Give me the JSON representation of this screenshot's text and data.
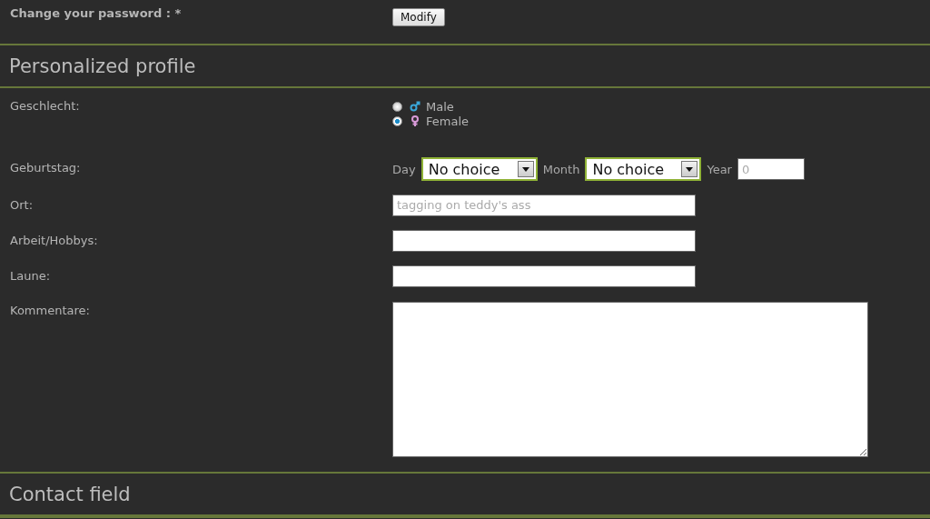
{
  "password_row": {
    "label": "Change your password : *",
    "button": "Modify"
  },
  "sections": [
    {
      "title": "Personalized profile",
      "fields": [
        {
          "kind": "radio",
          "label": "Geschlecht:",
          "options": [
            {
              "label": "Male",
              "kind": "male",
              "selected": false
            },
            {
              "label": "Female",
              "kind": "female",
              "selected": true
            }
          ]
        },
        {
          "kind": "date",
          "label": "Geburtstag:",
          "parts": [
            {
              "kind": "select",
              "label": "Day",
              "value": "No choice"
            },
            {
              "kind": "select",
              "label": "Month",
              "value": "No choice"
            },
            {
              "kind": "text",
              "label": "Year",
              "placeholder": "0"
            }
          ]
        },
        {
          "kind": "text",
          "label": "Ort:",
          "placeholder": "tagging on teddy's ass"
        },
        {
          "kind": "text",
          "label": "Arbeit/Hobbys:"
        },
        {
          "kind": "text",
          "label": "Laune:"
        },
        {
          "kind": "textarea",
          "label": "Kommentare:"
        }
      ]
    },
    {
      "title": "Contact field"
    }
  ]
}
